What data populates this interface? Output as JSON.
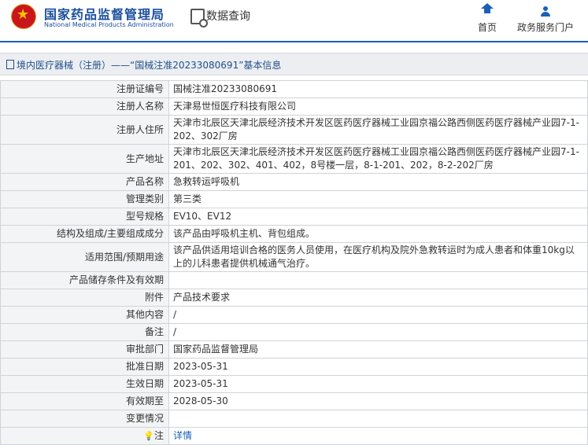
{
  "header": {
    "org_cn": "国家药品监督管理局",
    "org_en": "National Medical Products Administration",
    "db_title": "数据查询",
    "nav": [
      {
        "label": "首页",
        "icon": "home-icon"
      },
      {
        "label": "政务服务门户",
        "icon": "user-icon"
      }
    ]
  },
  "breadcrumb": "境内医疗器械（注册）——“国械注准20233080691”基本信息",
  "rows": [
    {
      "key": "注册证编号",
      "value": "国械注准20233080691"
    },
    {
      "key": "注册人名称",
      "value": "天津易世恒医疗科技有限公司"
    },
    {
      "key": "注册人住所",
      "value": "天津市北辰区天津北辰经济技术开发区医药医疗器械工业园京福公路西侧医药医疗器械产业园7-1-202、302厂房"
    },
    {
      "key": "生产地址",
      "value": "天津市北辰区天津北辰经济技术开发区医药医疗器械工业园京福公路西侧医药医疗器械产业园7-1-201、202、302、401、402，8号楼一层，8-1-201、202，8-2-202厂房"
    },
    {
      "key": "产品名称",
      "value": "急救转运呼吸机"
    },
    {
      "key": "管理类别",
      "value": "第三类"
    },
    {
      "key": "型号规格",
      "value": "EV10、EV12"
    },
    {
      "key": "结构及组成/主要组成成分",
      "value": "该产品由呼吸机主机、背包组成。"
    },
    {
      "key": "适用范围/预期用途",
      "value": "该产品供适用培训合格的医务人员使用，在医疗机构及院外急救转运时为成人患者和体重10kg以上的儿科患者提供机械通气治疗。"
    },
    {
      "key": "产品储存条件及有效期",
      "value": ""
    },
    {
      "key": "附件",
      "value": "产品技术要求"
    },
    {
      "key": "其他内容",
      "value": "/"
    },
    {
      "key": "备注",
      "value": "/"
    },
    {
      "key": "审批部门",
      "value": "国家药品监督管理局"
    },
    {
      "key": "批准日期",
      "value": "2023-05-31"
    },
    {
      "key": "生效日期",
      "value": "2023-05-31"
    },
    {
      "key": "有效期至",
      "value": "2028-05-30"
    },
    {
      "key": "变更情况",
      "value": ""
    }
  ],
  "note": {
    "key": "注",
    "link": "详情"
  }
}
